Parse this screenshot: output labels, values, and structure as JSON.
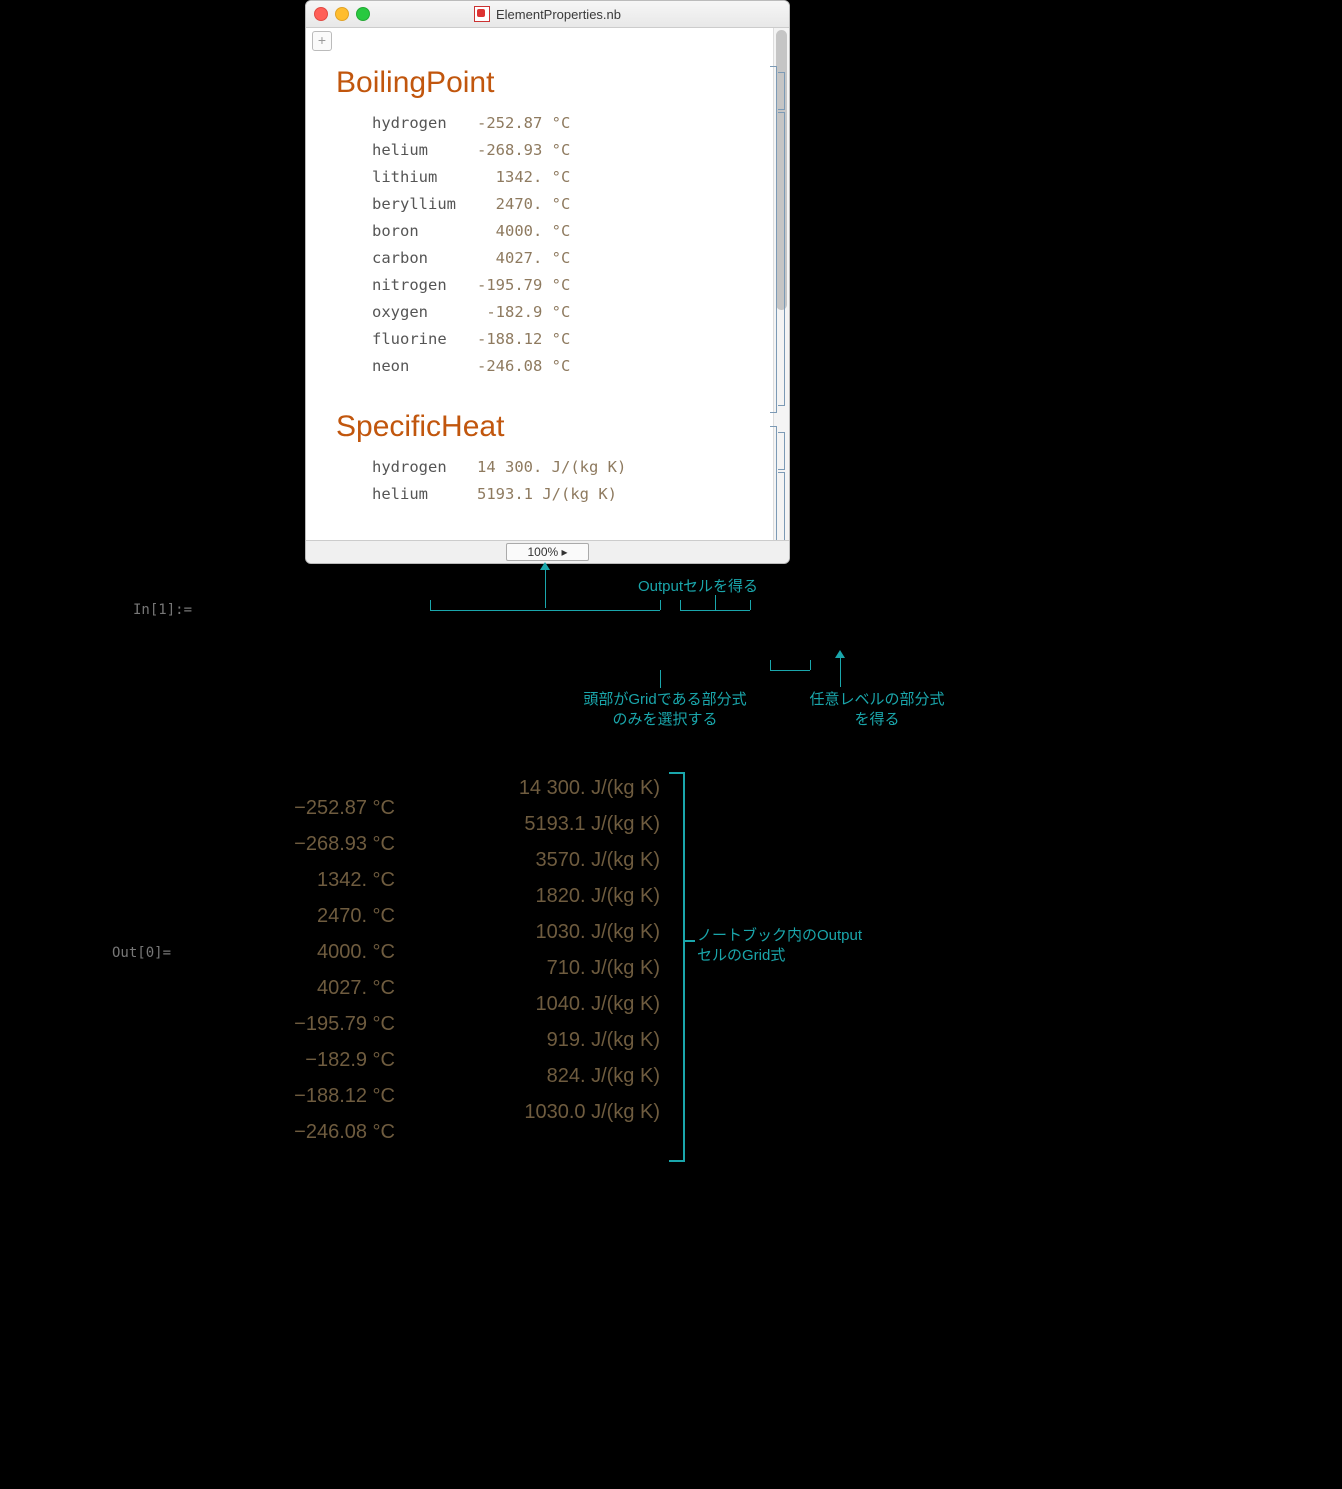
{
  "window": {
    "title": "ElementProperties.nb",
    "zoom": "100% ▸",
    "addtab": "+"
  },
  "sections": {
    "boiling": {
      "title": "BoilingPoint",
      "rows": [
        {
          "name": "hydrogen",
          "value": "-252.87 °C"
        },
        {
          "name": "helium",
          "value": "-268.93 °C"
        },
        {
          "name": "lithium",
          "value": "  1342. °C"
        },
        {
          "name": "beryllium",
          "value": "  2470. °C"
        },
        {
          "name": "boron",
          "value": "  4000. °C"
        },
        {
          "name": "carbon",
          "value": "  4027. °C"
        },
        {
          "name": "nitrogen",
          "value": "-195.79 °C"
        },
        {
          "name": "oxygen",
          "value": " -182.9 °C"
        },
        {
          "name": "fluorine",
          "value": "-188.12 °C"
        },
        {
          "name": "neon",
          "value": "-246.08 °C"
        }
      ]
    },
    "specific": {
      "title": "SpecificHeat",
      "rows": [
        {
          "name": "hydrogen",
          "value": "14 300. J/(kg K)"
        },
        {
          "name": "helium",
          "value": "5193.1 J/(kg K)"
        }
      ]
    }
  },
  "labels": {
    "in": "In[1]:=",
    "out": "Out[0]="
  },
  "annotations": {
    "a1": "Outputセルを得る",
    "a2": "頭部がGridである部分式\nのみを選択する",
    "a3": "任意レベルの部分式\nを得る",
    "a4": "ノートブック内のOutput\nセルのGrid式"
  },
  "output": {
    "col1": [
      "−252.87 °C",
      "−268.93 °C",
      "1342. °C",
      "2470. °C",
      "4000. °C",
      "4027. °C",
      "−195.79 °C",
      "−182.9 °C",
      "−188.12 °C",
      "−246.08 °C"
    ],
    "col2": [
      "14 300. J/(kg K)",
      "5193.1 J/(kg K)",
      "3570. J/(kg K)",
      "1820. J/(kg K)",
      "1030. J/(kg K)",
      "710. J/(kg K)",
      "1040. J/(kg K)",
      "919. J/(kg K)",
      "824. J/(kg K)",
      "1030.0 J/(kg K)"
    ]
  }
}
